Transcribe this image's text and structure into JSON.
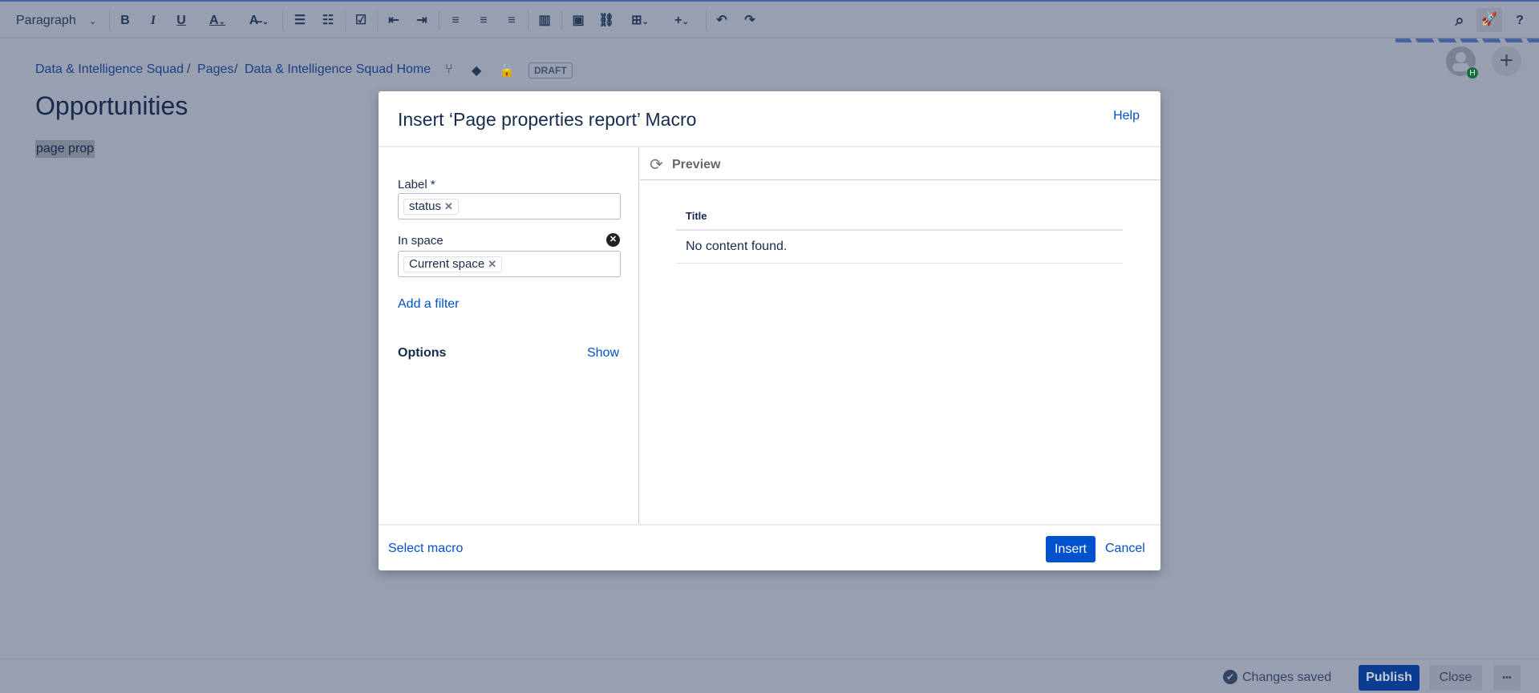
{
  "toolbar": {
    "paragraph": "Paragraph",
    "bold": "B",
    "italic": "I",
    "underline": "U",
    "text_color": "A",
    "undo": "↶",
    "redo": "↷",
    "search": "⌕",
    "help": "?"
  },
  "breadcrumb": [
    "Data & Intelligence Squad",
    "Pages",
    "Data & Intelligence Squad Home"
  ],
  "breadcrumb_sep": "/",
  "status_badge": "DRAFT",
  "page": {
    "title": "Opportunities",
    "content": "page prop"
  },
  "avatar_badge": "H",
  "dialog": {
    "title": "Insert ‘Page properties report’ Macro",
    "help": "Help",
    "label_field": {
      "label": "Label *",
      "tags": [
        "status"
      ]
    },
    "space_field": {
      "label": "In space",
      "tags": [
        "Current space"
      ]
    },
    "add_filter": "Add a filter",
    "options": "Options",
    "show": "Show",
    "preview": {
      "title": "Preview",
      "column": "Title",
      "empty": "No content found."
    },
    "select_macro": "Select macro",
    "insert": "Insert",
    "cancel": "Cancel"
  },
  "footer": {
    "status": "Changes saved",
    "publish": "Publish",
    "close": "Close",
    "more": "•••"
  },
  "colors": {
    "primary": "#0052cc",
    "overlay": "#979fb0"
  }
}
